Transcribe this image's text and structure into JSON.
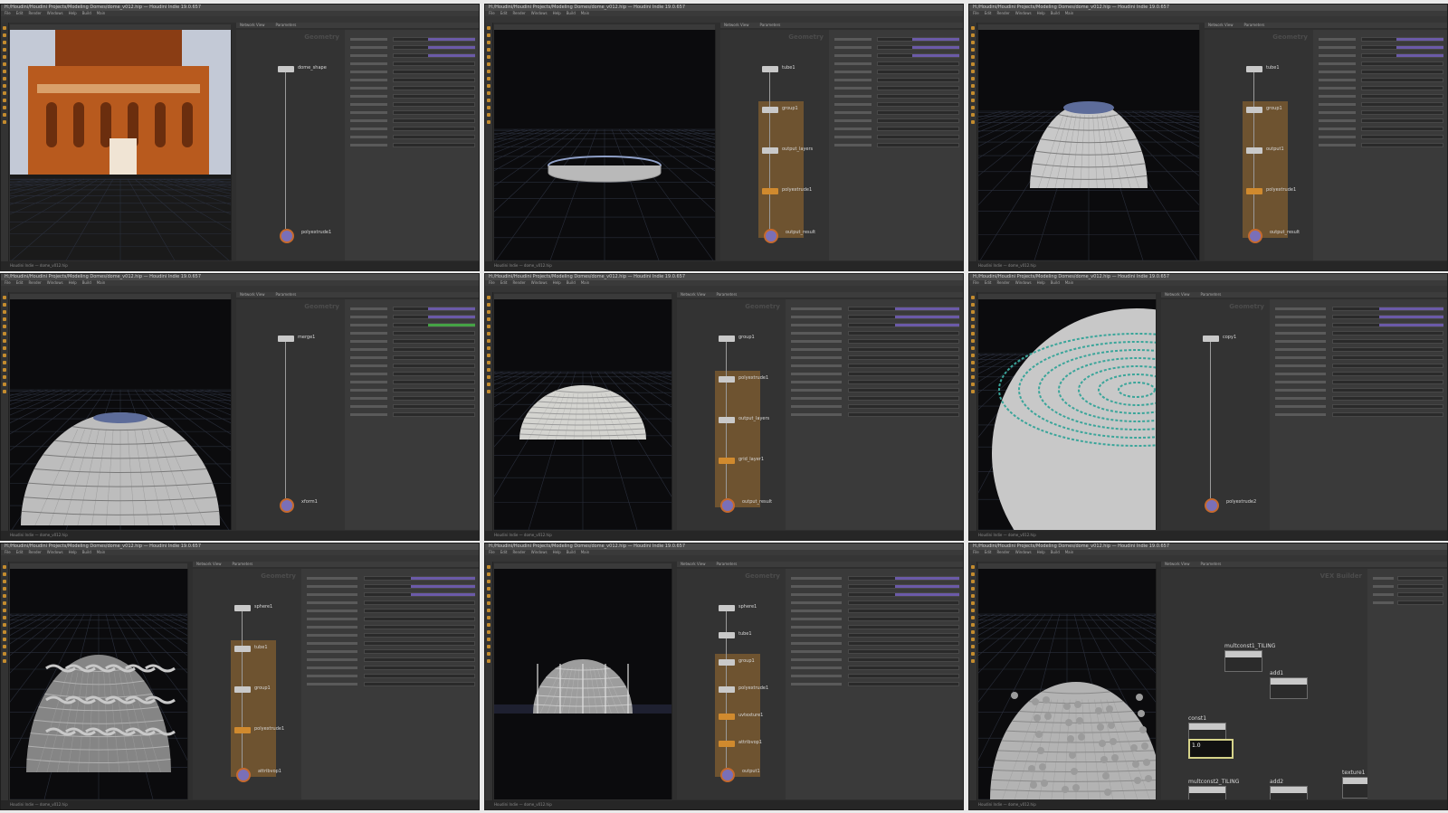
{
  "app": {
    "title": "H:/Houdini/Houdini Projects/Modeling Domes/dome_v012.hip — Houdini Indie 19.0.657",
    "menu": [
      "File",
      "Edit",
      "Render",
      "Windows",
      "Help",
      "Build",
      "Main"
    ],
    "tabs": [
      "Scene View",
      "Network View",
      "Parameters"
    ],
    "context_label": "Geometry",
    "status_text": "Houdini Indie — dome_v012.hip"
  },
  "panels": [
    {
      "id": "p1",
      "viewport": "reference-image",
      "nodes": [
        {
          "label": "dome_shape"
        },
        {
          "label": "polyextrude1"
        }
      ]
    },
    {
      "id": "p2",
      "viewport": "ring",
      "nodes": [
        {
          "label": "tube1"
        },
        {
          "label": "group1"
        },
        {
          "label": "output_layers"
        },
        {
          "label": "polyextrude1"
        },
        {
          "label": "output_result"
        }
      ]
    },
    {
      "id": "p3",
      "viewport": "stepped-dome",
      "nodes": [
        {
          "label": "tube1"
        },
        {
          "label": "group1"
        },
        {
          "label": "output1"
        },
        {
          "label": "polyextrude1"
        },
        {
          "label": "output_result"
        }
      ]
    },
    {
      "id": "p4",
      "viewport": "stepped-dome-side",
      "nodes": [
        {
          "label": "merge1"
        },
        {
          "label": "xform1"
        }
      ]
    },
    {
      "id": "p5",
      "viewport": "smooth-dome",
      "nodes": [
        {
          "label": "group1"
        },
        {
          "label": "polyextrude1"
        },
        {
          "label": "output_layers"
        },
        {
          "label": "grid_layer1"
        },
        {
          "label": "output_result"
        }
      ]
    },
    {
      "id": "p6",
      "viewport": "dome-wire-closeup",
      "nodes": [
        {
          "label": "copy1"
        },
        {
          "label": "polyextrude2"
        }
      ]
    },
    {
      "id": "p7",
      "viewport": "textured-dome",
      "nodes": [
        {
          "label": "sphere1"
        },
        {
          "label": "tube1"
        },
        {
          "label": "group1"
        },
        {
          "label": "polyextrude1"
        },
        {
          "label": "attribvop1"
        }
      ]
    },
    {
      "id": "p8",
      "viewport": "tiled-dome",
      "nodes": [
        {
          "label": "sphere1"
        },
        {
          "label": "tube1"
        },
        {
          "label": "group1"
        },
        {
          "label": "polyextrude1"
        },
        {
          "label": "uvtexture1"
        },
        {
          "label": "attribvop1"
        },
        {
          "label": "output1"
        }
      ]
    },
    {
      "id": "p9",
      "viewport": "noise-dome",
      "vex": {
        "title": "VEX Builder",
        "nodes": [
          {
            "label": "multconst1_TILING"
          },
          {
            "label": "add1"
          },
          {
            "label": "const1"
          },
          {
            "label": "multconst2_TILING"
          },
          {
            "label": "add2"
          },
          {
            "label": "texture1"
          }
        ],
        "const_value": "1.0"
      }
    }
  ],
  "colors": {
    "accent": "#d08a2e",
    "node_selected": "#c66a2e",
    "slider": "#6b5aa8",
    "highlight_green": "#45a345"
  }
}
